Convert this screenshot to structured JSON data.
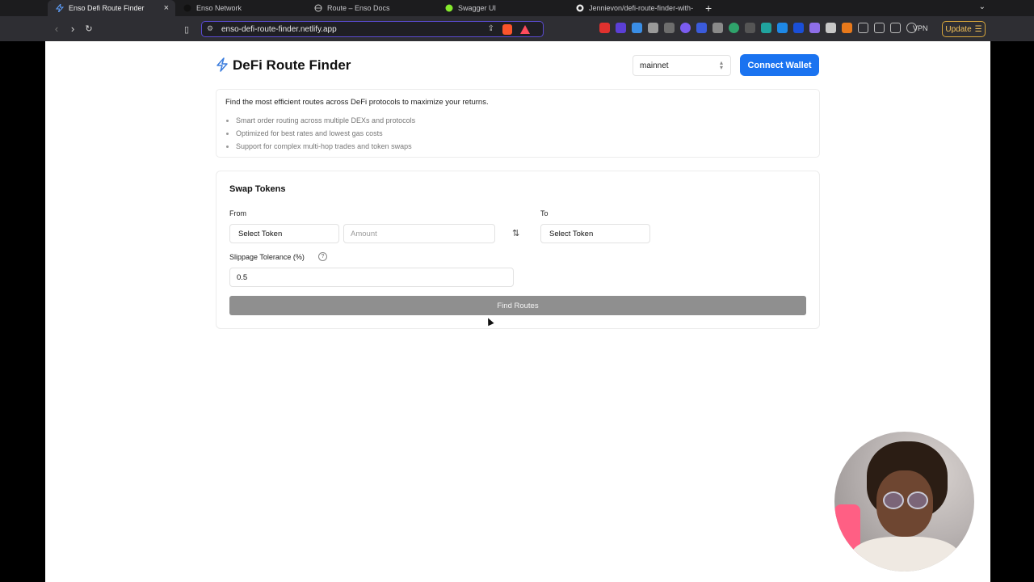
{
  "browser": {
    "tabs": [
      {
        "label": "Enso Defi Route Finder",
        "active": true
      },
      {
        "label": "Enso Network",
        "active": false
      },
      {
        "label": "Route – Enso Docs",
        "active": false
      },
      {
        "label": "Swagger UI",
        "active": false
      },
      {
        "label": "Jennievon/defi-route-finder-with-",
        "active": false
      }
    ],
    "new_tab": "+",
    "url": "enso-defi-route-finder.netlify.app",
    "vpn_label": "VPN",
    "update_label": "Update"
  },
  "app": {
    "title": "DeFi Route Finder",
    "network": "mainnet",
    "connect_label": "Connect Wallet",
    "accent_color": "#1a73f0"
  },
  "info": {
    "lead": "Find the most efficient routes across DeFi protocols to maximize your returns.",
    "bullets": [
      "Smart order routing across multiple DEXs and protocols",
      "Optimized for best rates and lowest gas costs",
      "Support for complex multi-hop trades and token swaps"
    ]
  },
  "swap": {
    "title": "Swap Tokens",
    "from_label": "From",
    "to_label": "To",
    "from_token": "Select Token",
    "amount_placeholder": "Amount",
    "to_token": "Select Token",
    "slippage_label": "Slippage Tolerance (%)",
    "slippage_value": "0.5",
    "find_label": "Find Routes"
  }
}
